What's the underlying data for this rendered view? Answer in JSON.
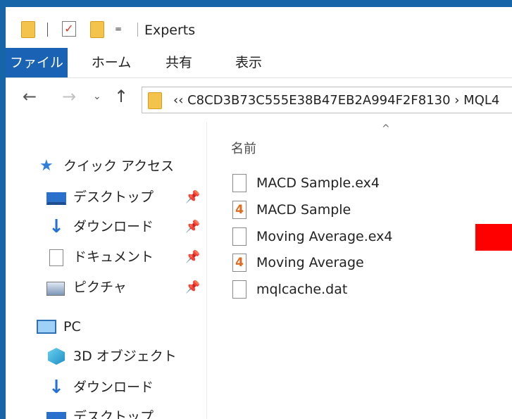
{
  "window": {
    "title": "Experts",
    "quick_access_toolbar": {
      "check_glyph": "✓",
      "dropdown_glyph": "="
    }
  },
  "ribbon": {
    "tabs": [
      {
        "label": "ファイル"
      },
      {
        "label": "ホーム"
      },
      {
        "label": "共有"
      },
      {
        "label": "表示"
      }
    ]
  },
  "navigation": {
    "back_glyph": "←",
    "forward_glyph": "→",
    "recent_glyph": "⌄",
    "up_glyph": "↑",
    "address": {
      "text": "‹‹  C8CD3B73C555E38B47EB2A994F2F8130  ›  MQL4"
    }
  },
  "sidebar": {
    "pin_glyph": "📌",
    "items": [
      {
        "label": "クイック アクセス",
        "icon": "star-icon"
      },
      {
        "label": "デスクトップ",
        "icon": "desktop-icon",
        "pinned": true
      },
      {
        "label": "ダウンロード",
        "icon": "download-icon",
        "pinned": true
      },
      {
        "label": "ドキュメント",
        "icon": "documents-icon",
        "pinned": true
      },
      {
        "label": "ピクチャ",
        "icon": "pictures-icon",
        "pinned": true
      },
      {
        "label": "PC",
        "icon": "pc-icon"
      },
      {
        "label": "3D オブジェクト",
        "icon": "3d-objects-icon"
      },
      {
        "label": "ダウンロード",
        "icon": "download-icon"
      },
      {
        "label": "デスクトップ",
        "icon": "desktop-icon"
      }
    ]
  },
  "file_list": {
    "sort_glyph": "^",
    "column_header": "名前",
    "mq4_glyph": "4",
    "files": [
      {
        "name": "MACD Sample.ex4",
        "icon": "file-icon"
      },
      {
        "name": "MACD Sample",
        "icon": "mq4-file-icon"
      },
      {
        "name": "Moving Average.ex4",
        "icon": "file-icon"
      },
      {
        "name": "Moving Average",
        "icon": "mq4-file-icon"
      },
      {
        "name": "mqlcache.dat",
        "icon": "file-icon"
      }
    ]
  },
  "colors": {
    "accent": "#1a63b4",
    "desktop_background": "#1565a8",
    "highlight_marker": "#ff0000"
  }
}
